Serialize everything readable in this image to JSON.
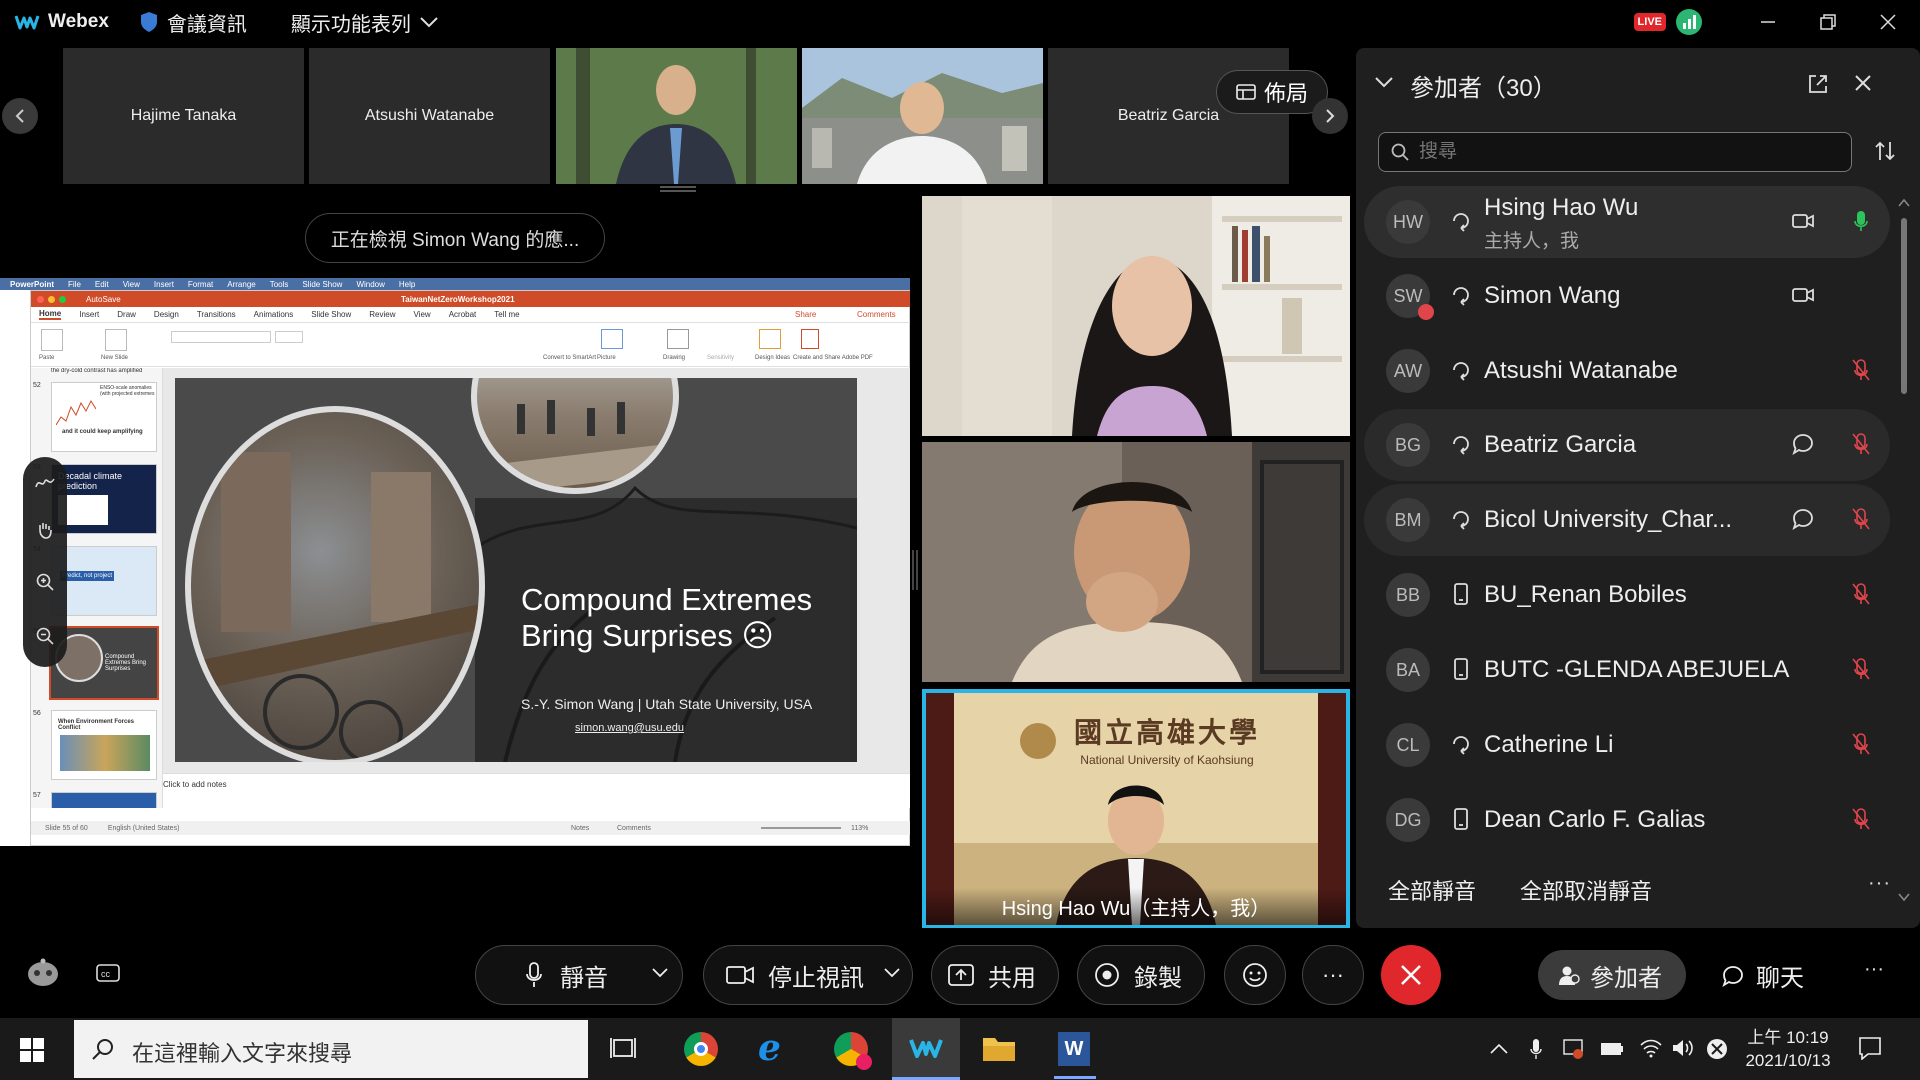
{
  "titlebar": {
    "app_name": "Webex",
    "meeting_info": "會議資訊",
    "view_menu": "顯示功能表列",
    "live_badge": "LIVE"
  },
  "filmstrip": {
    "participants": [
      "Hajime Tanaka",
      "Atsushi Watanabe",
      "",
      "",
      "Beatriz Garcia"
    ],
    "layout_button": "佈局"
  },
  "share": {
    "banner": "正在檢視 Simon Wang 的應..."
  },
  "ppt": {
    "menu": [
      "PowerPoint",
      "File",
      "Edit",
      "View",
      "Insert",
      "Format",
      "Arrange",
      "Tools",
      "Slide Show",
      "Window",
      "Help"
    ],
    "doc_title": "TaiwanNetZeroWorkshop2021",
    "autosave": "AutoSave",
    "ribbon_tabs": [
      "Home",
      "Insert",
      "Draw",
      "Design",
      "Transitions",
      "Animations",
      "Slide Show",
      "Review",
      "View",
      "Acrobat",
      "Tell me"
    ],
    "share_label": "Share",
    "comments_label": "Comments",
    "ribbon_tools": [
      "Paste",
      "New Slide",
      "Convert to SmartArt",
      "Picture",
      "Drawing",
      "Sensitivity",
      "Design Ideas",
      "Create and Share Adobe PDF"
    ],
    "thumbs": [
      {
        "num": "52",
        "title": "and it could keep amplifying"
      },
      {
        "num": "53",
        "title": "Decadal climate prediction"
      },
      {
        "num": "54",
        "title": "Predict, not project"
      },
      {
        "num": "55",
        "title": "Compound Extremes Bring Surprises"
      },
      {
        "num": "56",
        "title": "When Environment Forces Conflict"
      },
      {
        "num": "57",
        "title": ""
      }
    ],
    "thumb_top_text": "the dry-cold contrast has amplified",
    "thumb_52_note": "ENSO-scale anomalies (with projected extremes",
    "slide_title_line1": "Compound Extremes",
    "slide_title_line2": "Bring Surprises ☹",
    "slide_author": "S.-Y. Simon Wang | Utah State University, USA",
    "slide_email": "simon.wang@usu.edu",
    "notes_placeholder": "Click to add notes",
    "status_left": "Slide 55 of 60",
    "status_lang": "English (United States)",
    "status_notes": "Notes",
    "status_comments": "Comments",
    "zoom": "113%"
  },
  "video": {
    "active_label": "Hsing Hao Wu（主持人，我）",
    "banner_cn": "國立高雄大學",
    "banner_en": "National University of Kaohsiung"
  },
  "panel": {
    "title": "參加者（30）",
    "search_placeholder": "搜尋",
    "participants": [
      {
        "initials": "HW",
        "name": "Hsing Hao Wu",
        "sub": "主持人，我"
      },
      {
        "initials": "SW",
        "name": "Simon Wang",
        "sub": ""
      },
      {
        "initials": "AW",
        "name": "Atsushi Watanabe",
        "sub": ""
      },
      {
        "initials": "BG",
        "name": "Beatriz Garcia",
        "sub": ""
      },
      {
        "initials": "BM",
        "name": "Bicol University_Char...",
        "sub": ""
      },
      {
        "initials": "BB",
        "name": "BU_Renan Bobiles",
        "sub": ""
      },
      {
        "initials": "BA",
        "name": "BUTC -GLENDA ABEJUELA",
        "sub": ""
      },
      {
        "initials": "CL",
        "name": "Catherine Li",
        "sub": ""
      },
      {
        "initials": "DG",
        "name": "Dean Carlo F. Galias",
        "sub": ""
      }
    ],
    "mute_all": "全部靜音",
    "unmute_all": "全部取消靜音"
  },
  "controls": {
    "mute": "靜音",
    "stop_video": "停止視訊",
    "share": "共用",
    "record": "錄製",
    "participants": "參加者",
    "chat": "聊天"
  },
  "taskbar": {
    "search_placeholder": "在這裡輸入文字來搜尋",
    "time": "上午 10:19",
    "date": "2021/10/13"
  },
  "colors": {
    "accent_blue": "#29b6e6",
    "end_red": "#e0272c",
    "mic_green": "#2bc45c",
    "muted_red": "#e0454c",
    "ppt_orange": "#d04b27"
  }
}
